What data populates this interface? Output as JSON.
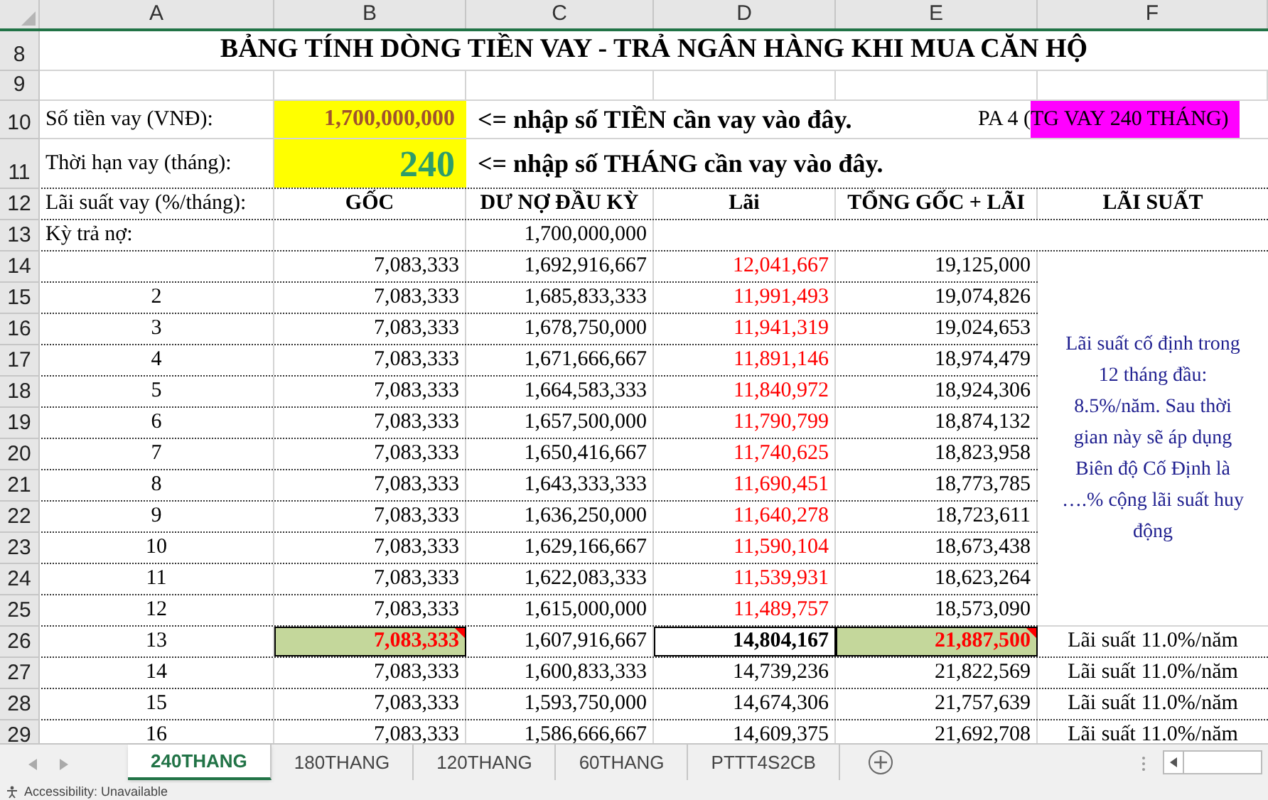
{
  "column_headers": [
    {
      "label": "A",
      "selected": false
    },
    {
      "label": "B",
      "selected": false
    },
    {
      "label": "C",
      "selected": false
    },
    {
      "label": "D",
      "selected": false
    },
    {
      "label": "E",
      "selected": false
    },
    {
      "label": "F",
      "selected": false
    }
  ],
  "title_row": {
    "number": "8",
    "text": "BẢNG TÍNH DÒNG TIỀN VAY - TRẢ NGÂN HÀNG KHI MUA CĂN HỘ"
  },
  "blank_row": {
    "number": "9"
  },
  "inputs": [
    {
      "number": "10",
      "kind": "amount",
      "label": "Số tiền vay (VNĐ):",
      "value": "1,700,000,000",
      "hint": "<= nhập số TIỀN cần vay vào đây.",
      "plan": "PA 4 (",
      "plan_highlight": "TG VAY 240 THÁNG)"
    },
    {
      "number": "11",
      "kind": "term",
      "label": "Thời hạn vay (tháng):",
      "value": "240",
      "hint": "<= nhập số THÁNG cần vay vào đây."
    }
  ],
  "header_row": {
    "number": "12",
    "cells": [
      "Lãi suất vay (%/tháng):",
      "GỐC",
      "DƯ NỢ ĐẦU KỲ",
      "Lãi",
      "TỔNG GỐC + LÃI",
      "LÃI SUẤT"
    ]
  },
  "opening_row": {
    "number": "13",
    "label": "Kỳ trả nợ:",
    "balance": "1,700,000,000"
  },
  "fixed_period": {
    "note": "Lãi suất cố định trong 12 tháng đầu: 8.5%/năm. Sau thời gian này sẽ áp dụng Biên độ Cố Định là ….% cộng lãi suất huy động",
    "rows": [
      {
        "number": "14",
        "principal": "7,083,333",
        "balance": "1,692,916,667",
        "interest": "12,041,667",
        "total": "19,125,000"
      },
      {
        "number": "15",
        "period": "2",
        "principal": "7,083,333",
        "balance": "1,685,833,333",
        "interest": "11,991,493",
        "total": "19,074,826"
      },
      {
        "number": "16",
        "period": "3",
        "principal": "7,083,333",
        "balance": "1,678,750,000",
        "interest": "11,941,319",
        "total": "19,024,653"
      },
      {
        "number": "17",
        "period": "4",
        "principal": "7,083,333",
        "balance": "1,671,666,667",
        "interest": "11,891,146",
        "total": "18,974,479"
      },
      {
        "number": "18",
        "period": "5",
        "principal": "7,083,333",
        "balance": "1,664,583,333",
        "interest": "11,840,972",
        "total": "18,924,306"
      },
      {
        "number": "19",
        "period": "6",
        "principal": "7,083,333",
        "balance": "1,657,500,000",
        "interest": "11,790,799",
        "total": "18,874,132"
      },
      {
        "number": "20",
        "period": "7",
        "principal": "7,083,333",
        "balance": "1,650,416,667",
        "interest": "11,740,625",
        "total": "18,823,958"
      },
      {
        "number": "21",
        "period": "8",
        "principal": "7,083,333",
        "balance": "1,643,333,333",
        "interest": "11,690,451",
        "total": "18,773,785"
      },
      {
        "number": "22",
        "period": "9",
        "principal": "7,083,333",
        "balance": "1,636,250,000",
        "interest": "11,640,278",
        "total": "18,723,611"
      },
      {
        "number": "23",
        "period": "10",
        "principal": "7,083,333",
        "balance": "1,629,166,667",
        "interest": "11,590,104",
        "total": "18,673,438"
      },
      {
        "number": "24",
        "period": "11",
        "principal": "7,083,333",
        "balance": "1,622,083,333",
        "interest": "11,539,931",
        "total": "18,623,264"
      },
      {
        "number": "25",
        "period": "12",
        "principal": "7,083,333",
        "balance": "1,615,000,000",
        "interest": "11,489,757",
        "total": "18,573,090"
      }
    ]
  },
  "later_rows": [
    {
      "number": "26",
      "period": "13",
      "principal": "7,083,333",
      "balance": "1,607,916,667",
      "interest": "14,804,167",
      "total": "21,887,500",
      "rate": "Lãi suất 11.0%/năm",
      "highlighted": true
    },
    {
      "number": "27",
      "period": "14",
      "principal": "7,083,333",
      "balance": "1,600,833,333",
      "interest": "14,739,236",
      "total": "21,822,569",
      "rate": "Lãi suất 11.0%/năm",
      "highlighted": false
    },
    {
      "number": "28",
      "period": "15",
      "principal": "7,083,333",
      "balance": "1,593,750,000",
      "interest": "14,674,306",
      "total": "21,757,639",
      "rate": "Lãi suất 11.0%/năm",
      "highlighted": false
    },
    {
      "number": "29",
      "period": "16",
      "principal": "7,083,333",
      "balance": "1,586,666,667",
      "interest": "14,609,375",
      "total": "21,692,708",
      "rate": "Lãi suất 11.0%/năm",
      "highlighted": false
    }
  ],
  "sheet_tabs": [
    {
      "label": "240THANG",
      "selected": true
    },
    {
      "label": "180THANG",
      "selected": false
    },
    {
      "label": "120THANG",
      "selected": false
    },
    {
      "label": "60THANG",
      "selected": false
    },
    {
      "label": "PTTT4S2CB",
      "selected": false
    }
  ],
  "status_bar": {
    "text": "Accessibility: Unavailable"
  }
}
